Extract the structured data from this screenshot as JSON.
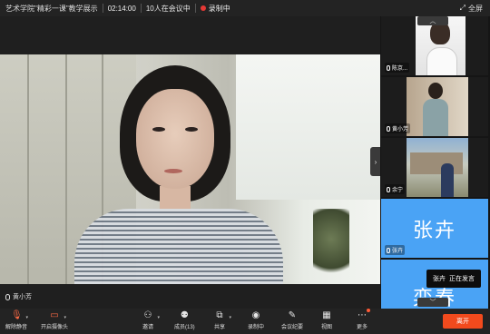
{
  "topbar": {
    "meeting_title": "艺术学院\"精彩一课\"教学展示",
    "timer": "02:14:00",
    "participants_status": "10人在会议中",
    "recording": "录制中",
    "fullscreen": "全屏"
  },
  "main": {
    "speaker_name": "黄小芳"
  },
  "sidebar": {
    "tiles": [
      {
        "name": "陈京..."
      },
      {
        "name": "黄小芳"
      },
      {
        "name": "余宁"
      },
      {
        "name": "张卉",
        "avatar_text": "张卉"
      },
      {
        "avatar_text": "栾春"
      }
    ],
    "speaking_tip_name": "张卉",
    "speaking_tip_status": "正在发言"
  },
  "toolbar": {
    "mute": "解除静音",
    "camera": "开启摄像头",
    "invite": "邀请",
    "members": "成员(13)",
    "share": "共享",
    "record": "录制中",
    "minutes": "会议纪要",
    "view": "视图",
    "more": "更多",
    "leave": "离开"
  },
  "colors": {
    "accent_blue": "#4aa3f5",
    "leave_red": "#f24a1d",
    "rec_red": "#e53935"
  }
}
